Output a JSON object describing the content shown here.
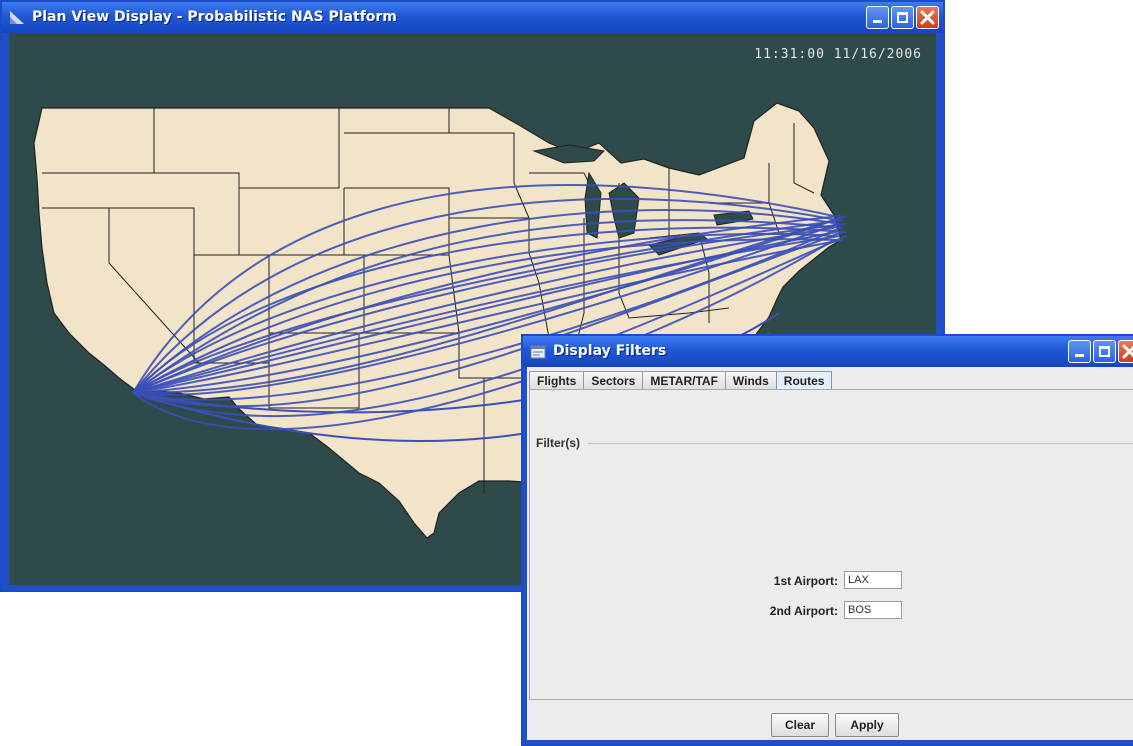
{
  "plan_window": {
    "title": "Plan View Display - Probabilistic NAS Platform",
    "clock": "11:31:00 11/16/2006",
    "icon": "app-logo-icon",
    "colors": {
      "background": "#2f4a4a",
      "land": "#f2e4c8",
      "route": "#3a4fb8"
    }
  },
  "filter_window": {
    "title": "Display Filters",
    "icon": "window-icon",
    "tabs": [
      "Flights",
      "Sectors",
      "METAR/TAF",
      "Winds",
      "Routes"
    ],
    "active_tab": "Routes",
    "filter_legend": "Filter(s)",
    "first_airport_label": "1st Airport:",
    "first_airport_value": "LAX",
    "second_airport_label": "2nd Airport:",
    "second_airport_value": "BOS",
    "clear_label": "Clear",
    "apply_label": "Apply"
  }
}
